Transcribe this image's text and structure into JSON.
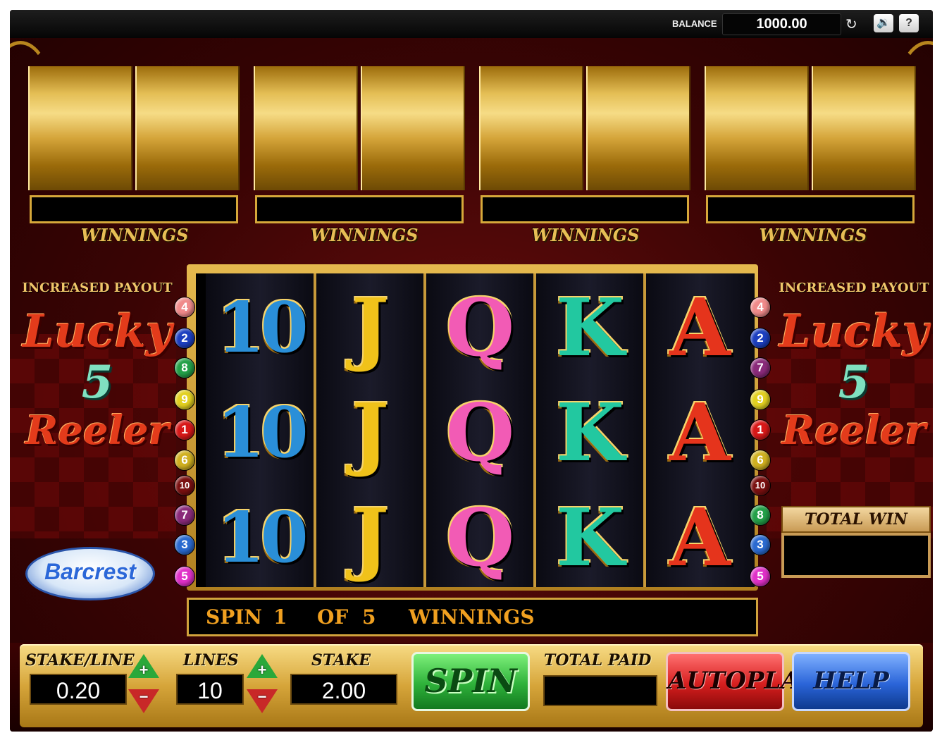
{
  "topbar": {
    "balance_label": "BALANCE",
    "balance_value": "1000.00",
    "refresh_icon": "↻",
    "sound_icon": "🔉",
    "help_icon": "?"
  },
  "boards": {
    "winnings_label": "WINNINGS"
  },
  "side_left": {
    "increased_payout": "INCREASED PAYOUT",
    "lucky": "Lucky",
    "five": "5",
    "reeler": "Reeler",
    "logo": "Barcrest"
  },
  "side_right": {
    "increased_payout": "INCREASED PAYOUT",
    "lucky": "Lucky",
    "five": "5",
    "reeler": "Reeler",
    "total_win_label": "TOTAL WIN"
  },
  "reels": {
    "symbols": [
      "10",
      "J",
      "Q",
      "K",
      "A"
    ],
    "colors": [
      "#2a8fd8",
      "#f0c21a",
      "#f25bb5",
      "#22c8a0",
      "#e5341c"
    ],
    "left_lines": [
      "4",
      "2",
      "8",
      "9",
      "1",
      "6",
      "10",
      "7",
      "3",
      "5"
    ],
    "right_lines": [
      "4",
      "2",
      "7",
      "9",
      "1",
      "6",
      "10",
      "8",
      "3",
      "5"
    ],
    "line_colors": {
      "1": "#d81818",
      "2": "#1c3fc0",
      "3": "#2a6ad0",
      "4": "#f08a8a",
      "5": "#e030c8",
      "6": "#d0b020",
      "7": "#8a2a7a",
      "8": "#23a048",
      "9": "#e2d020",
      "10": "#7a1010"
    }
  },
  "spin_bar": {
    "spin_label": "SPIN",
    "spin_number": "1",
    "of_label": "OF",
    "of_total": "5",
    "winnings_label": "WINNINGS"
  },
  "console": {
    "stake_line_label": "STAKE/LINE",
    "stake_line_value": "0.20",
    "lines_label": "LINES",
    "lines_value": "10",
    "stake_label": "STAKE",
    "stake_value": "2.00",
    "spin_button": "SPIN",
    "total_paid_label": "TOTAL PAID",
    "autoplay_button": "AUTOPLAY",
    "help_button": "HELP",
    "plus": "+",
    "minus": "−"
  }
}
